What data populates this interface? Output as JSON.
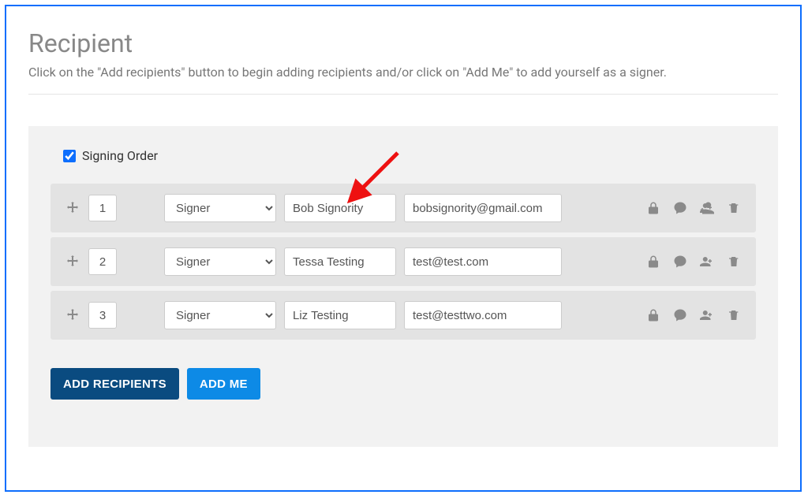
{
  "header": {
    "title": "Recipient",
    "instructions": "Click on the \"Add recipients\" button to begin adding recipients and/or click on \"Add Me\" to add yourself as a signer."
  },
  "signingOrder": {
    "label": "Signing Order",
    "checked": true
  },
  "roleOptions": [
    "Signer"
  ],
  "recipients": [
    {
      "order": "1",
      "role": "Signer",
      "name": "Bob Signority",
      "email": "bobsignority@gmail.com"
    },
    {
      "order": "2",
      "role": "Signer",
      "name": "Tessa Testing",
      "email": "test@test.com"
    },
    {
      "order": "3",
      "role": "Signer",
      "name": "Liz Testing",
      "email": "test@testtwo.com"
    }
  ],
  "buttons": {
    "addRecipients": "ADD RECIPIENTS",
    "addMe": "ADD ME"
  }
}
